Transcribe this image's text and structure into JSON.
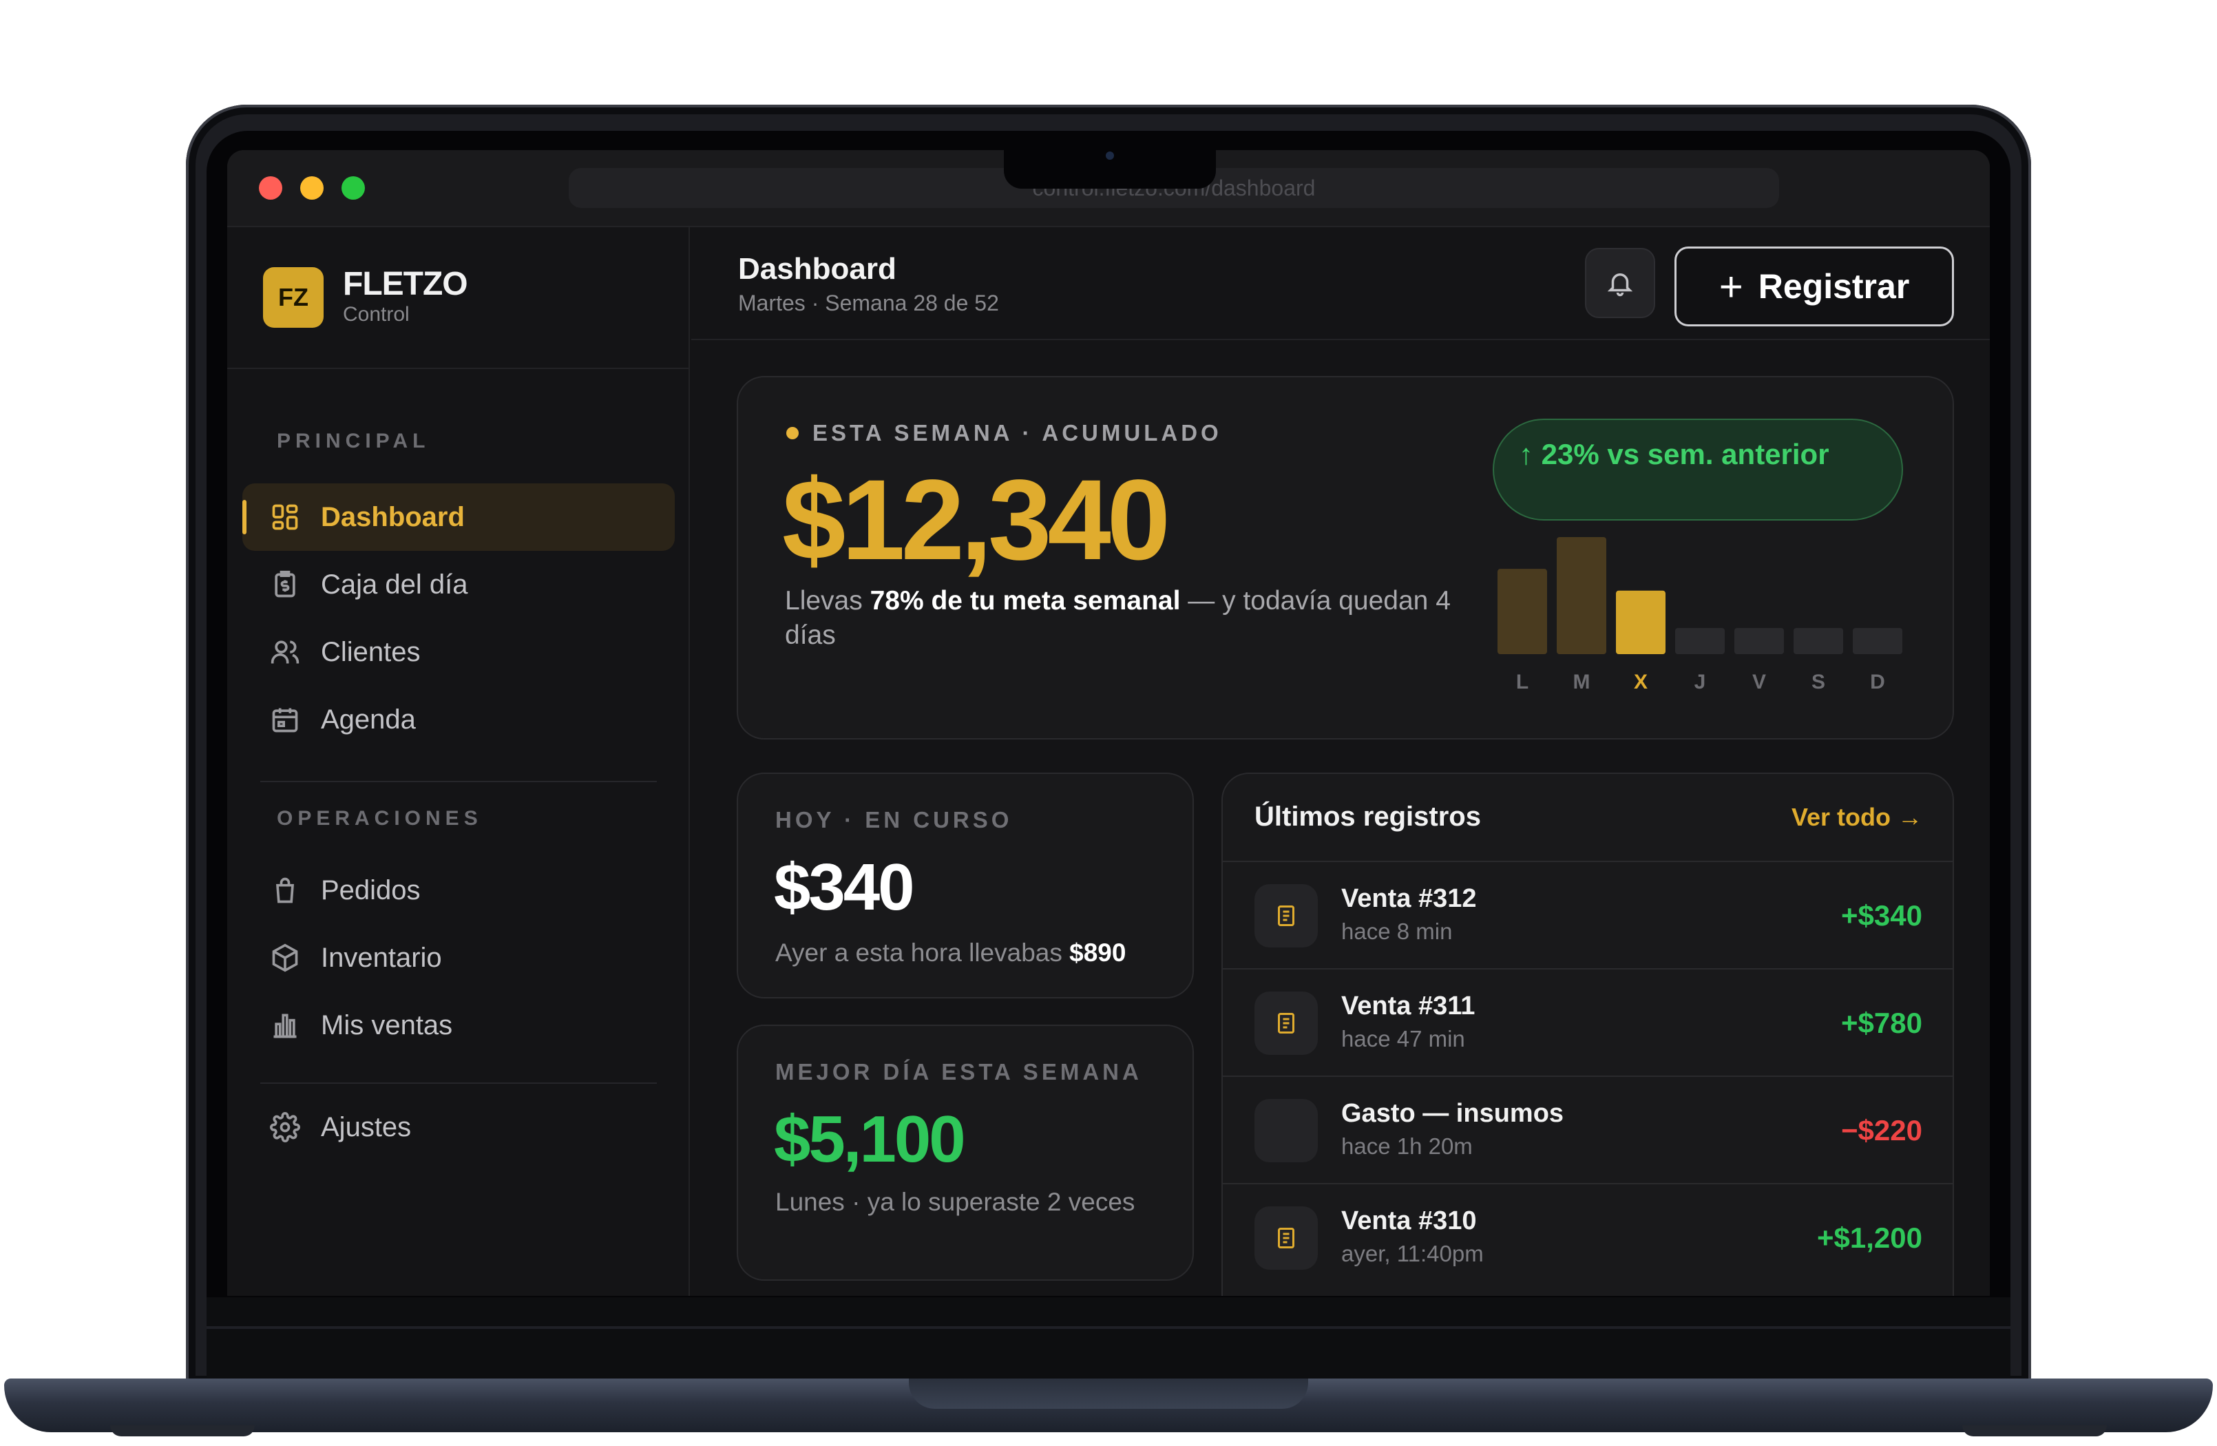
{
  "browser": {
    "url": "control.fletzo.com/dashboard"
  },
  "brand": {
    "logo_text": "FZ",
    "name": "FLETZO",
    "subtitle": "Control"
  },
  "sidebar": {
    "principal_label": "PRINCIPAL",
    "operaciones_label": "OPERACIONES",
    "items": [
      {
        "label": "Dashboard",
        "icon": "grid-icon",
        "active": true
      },
      {
        "label": "Caja del día",
        "icon": "cash-icon"
      },
      {
        "label": "Clientes",
        "icon": "users-icon"
      },
      {
        "label": "Agenda",
        "icon": "calendar-icon"
      },
      {
        "label": "Pedidos",
        "icon": "bag-icon"
      },
      {
        "label": "Inventario",
        "icon": "box-icon"
      },
      {
        "label": "Mis ventas",
        "icon": "bar-chart-icon"
      },
      {
        "label": "Ajustes",
        "icon": "gear-icon"
      }
    ]
  },
  "header": {
    "title": "Dashboard",
    "subtitle": "Martes · Semana 28 de 52",
    "register_label": "Registrar",
    "register_plus": "+"
  },
  "hero": {
    "eyebrow": "ESTA SEMANA · ACUMULADO",
    "amount": "$12,340",
    "desc_pre": "Llevas ",
    "desc_bold": "78% de tu meta semanal",
    "desc_post": " — y todavía quedan 4 días",
    "trend": "↑ 23% vs sem. anterior"
  },
  "chart_data": {
    "type": "bar",
    "categories": [
      "L",
      "M",
      "X",
      "J",
      "V",
      "S",
      "D"
    ],
    "values": [
      5100,
      7000,
      3800,
      0,
      0,
      0,
      0
    ],
    "highlight_index": 2,
    "colors": {
      "past": "#4a3b1f",
      "today": "#d4a62a",
      "future": "#2a2a2d",
      "label": "#6d6d72",
      "label_today": "#e0ac2e"
    }
  },
  "today_card": {
    "label": "HOY · EN CURSO",
    "amount": "$340",
    "desc_pre": "Ayer a esta hora llevabas ",
    "desc_bold": "$890"
  },
  "best_card": {
    "label": "MEJOR DÍA ESTA SEMANA",
    "amount": "$5,100",
    "desc": "Lunes · ya lo superaste 2 veces"
  },
  "records": {
    "title": "Últimos registros",
    "link": "Ver todo →",
    "rows": [
      {
        "name": "Venta #312",
        "time": "hace 8 min",
        "amount": "+$340",
        "type": "pos",
        "icon": "receipt-icon"
      },
      {
        "name": "Venta #311",
        "time": "hace 47 min",
        "amount": "+$780",
        "type": "pos",
        "icon": "receipt-icon"
      },
      {
        "name": "Gasto — insumos",
        "time": "hace 1h 20m",
        "amount": "−$220",
        "type": "neg",
        "icon": ""
      },
      {
        "name": "Venta #310",
        "time": "ayer, 11:40pm",
        "amount": "+$1,200",
        "type": "pos",
        "icon": "receipt-icon"
      }
    ]
  },
  "colors": {
    "accent": "#e0ac2e",
    "positive": "#2fc75a",
    "negative": "#ef4444",
    "background": "#141416"
  }
}
